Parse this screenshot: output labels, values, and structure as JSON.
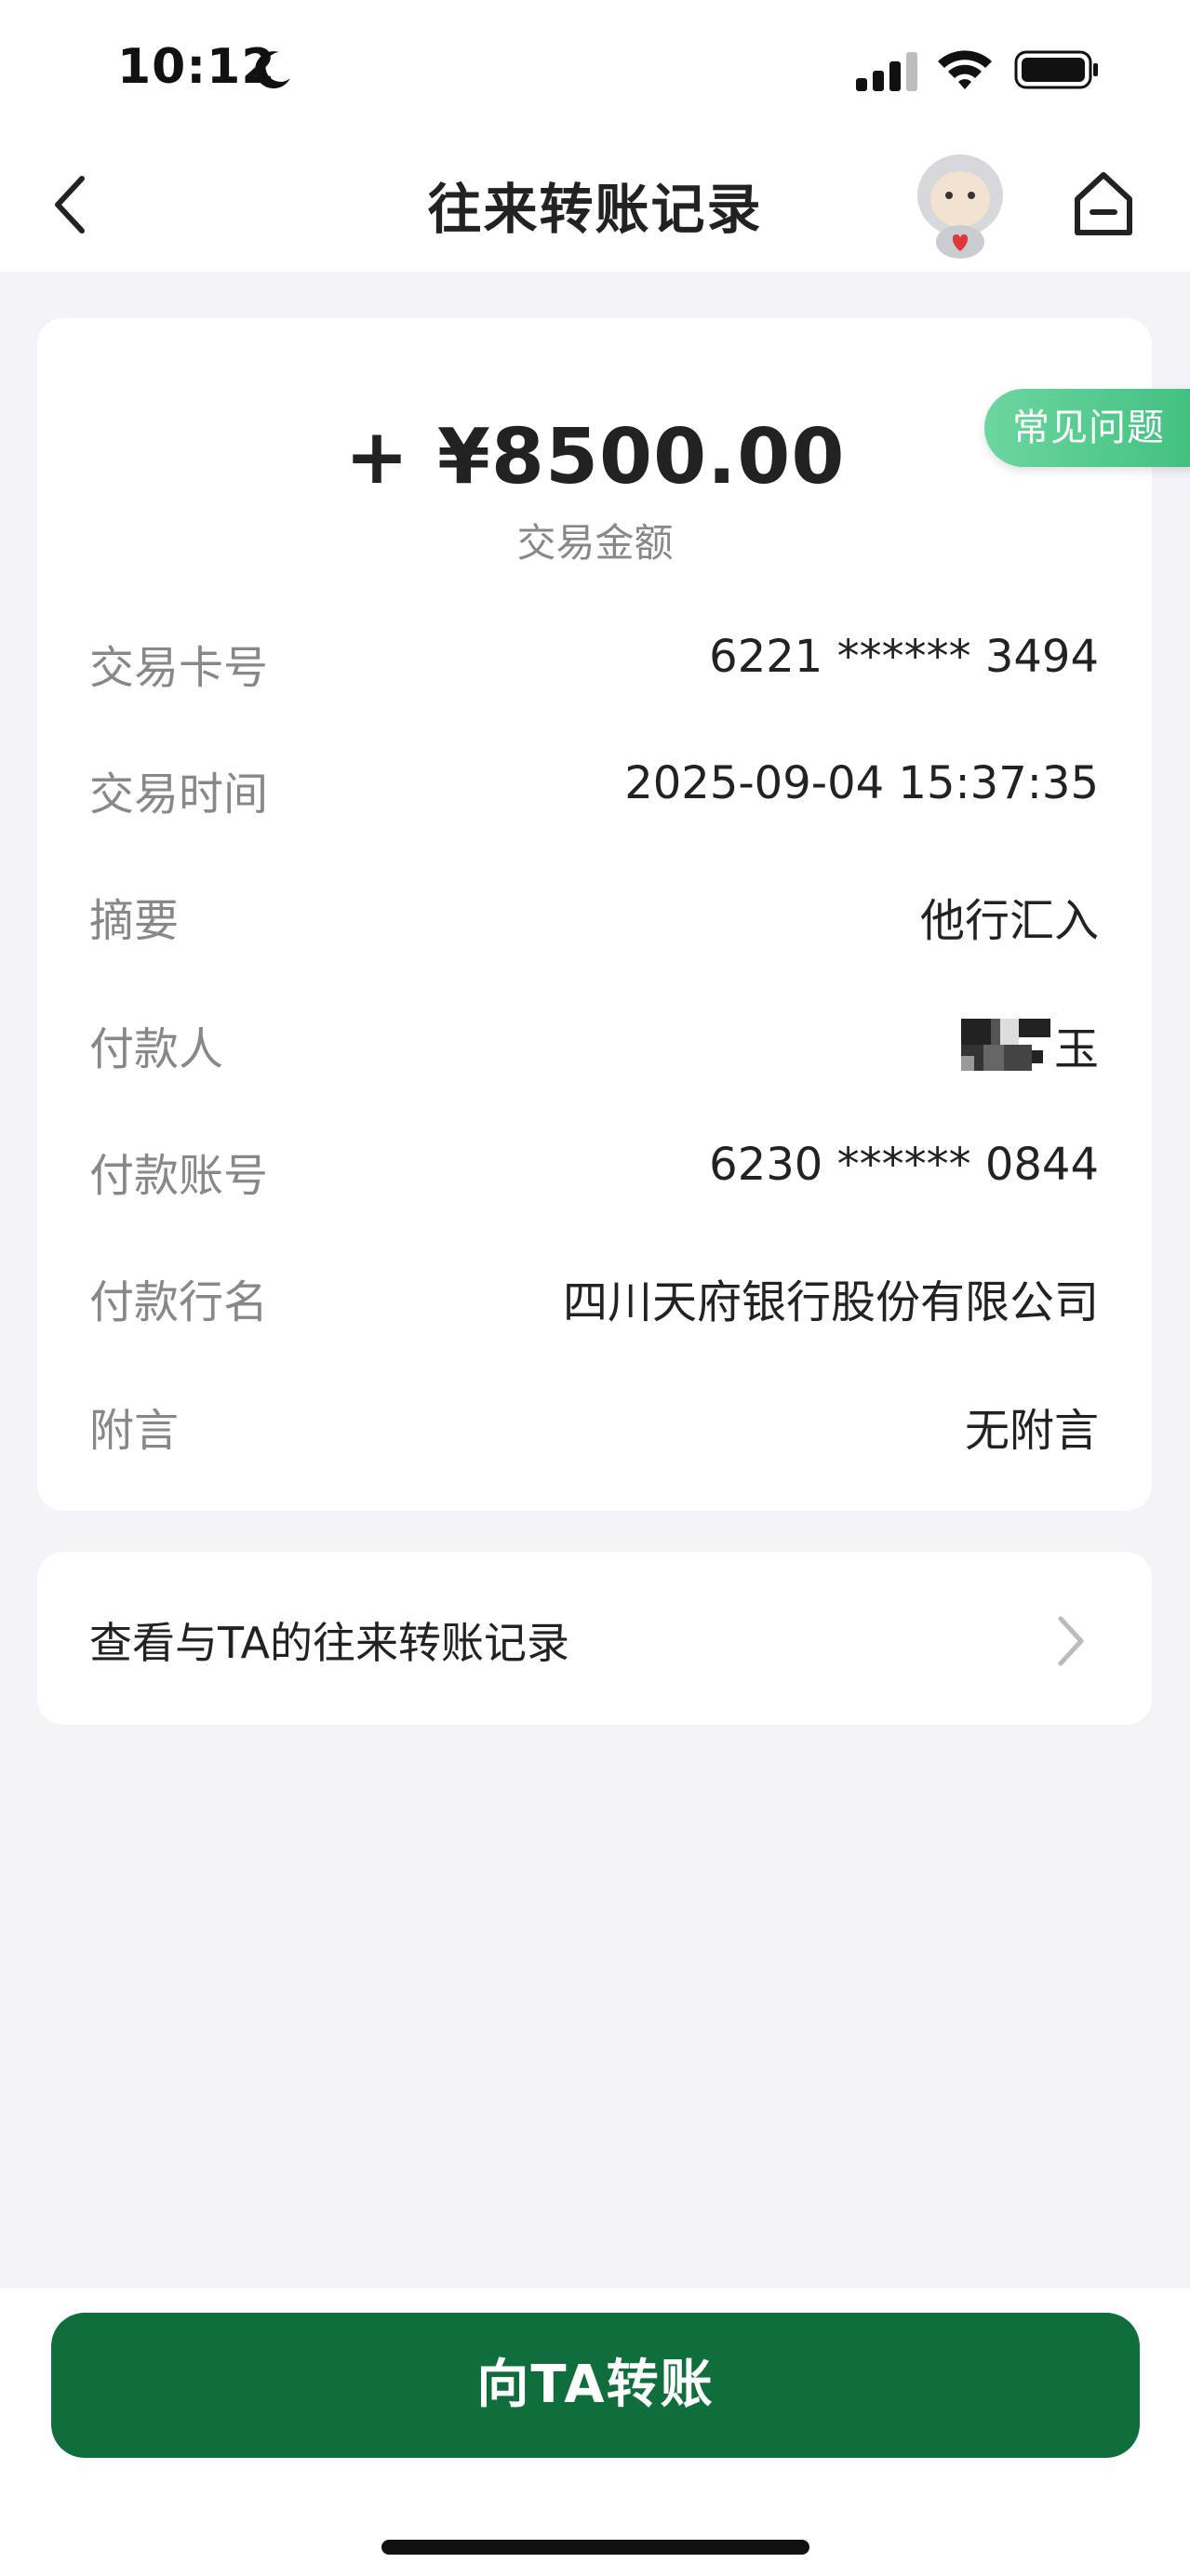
{
  "status_bar": {
    "time": "10:12"
  },
  "nav": {
    "title": "往来转账记录"
  },
  "faq_tag": "常见问题",
  "transaction": {
    "amount": "+ ¥8500.00",
    "amount_label": "交易金额",
    "rows": [
      {
        "label": "交易卡号",
        "value": "6221 ****** 3494"
      },
      {
        "label": "交易时间",
        "value": "2025-09-04 15:37:35"
      },
      {
        "label": "摘要",
        "value": "他行汇入"
      },
      {
        "label": "付款人",
        "value": "玉"
      },
      {
        "label": "付款账号",
        "value": "6230 ****** 0844"
      },
      {
        "label": "付款行名",
        "value": "四川天府银行股份有限公司"
      },
      {
        "label": "附言",
        "value": "无附言"
      }
    ]
  },
  "history_link": {
    "label": "查看与TA的往来转账记录"
  },
  "transfer_button": {
    "label": "向TA转账"
  },
  "colors": {
    "primary_green": "#0f6e3c",
    "faq_green": "#4cc88a",
    "background": "#f3f3f8"
  },
  "icons": [
    "moon-icon",
    "signal-icon",
    "wifi-icon",
    "battery-icon",
    "back-icon",
    "mascot-icon",
    "home-icon",
    "chevron-right-icon"
  ]
}
